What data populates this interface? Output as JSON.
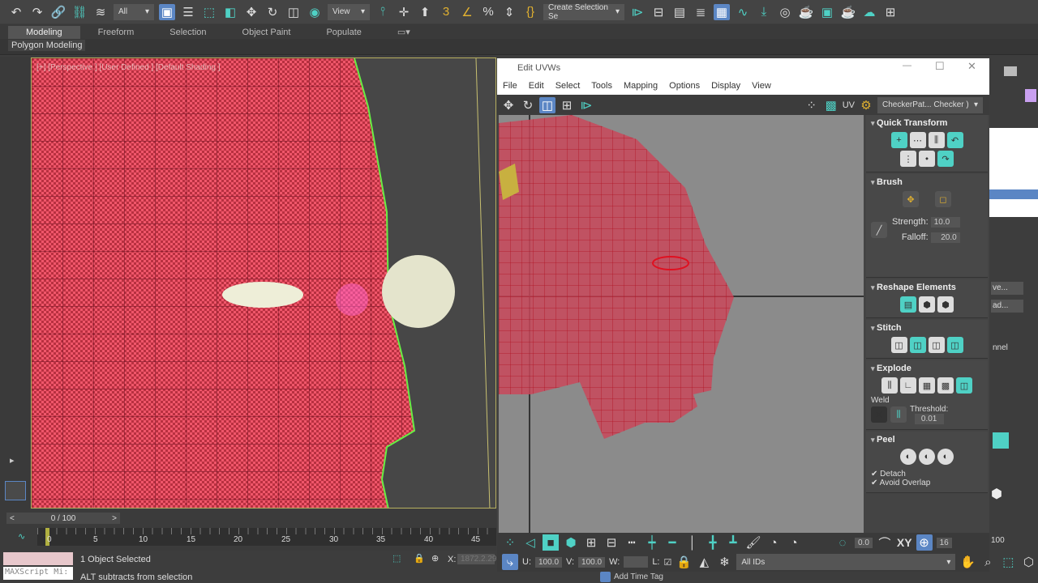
{
  "toolbar": {
    "filter_select": "All",
    "view_select": "View",
    "selection_set": "Create Selection Se"
  },
  "ribbon": {
    "tabs": [
      "Modeling",
      "Freeform",
      "Selection",
      "Object Paint",
      "Populate"
    ],
    "active": "Modeling",
    "sub": "Polygon Modeling"
  },
  "viewport": {
    "label": "[+] [Perspective ] [User Defined ] [Default Shading ]"
  },
  "uvw": {
    "title": "Edit UVWs",
    "menu": [
      "File",
      "Edit",
      "Select",
      "Tools",
      "Mapping",
      "Options",
      "Display",
      "View"
    ],
    "uv_label": "UV",
    "checker": "CheckerPat... Checker )",
    "rollouts": {
      "quick_transform": "Quick Transform",
      "brush": "Brush",
      "strength_label": "Strength:",
      "strength": "10.0",
      "falloff_label": "Falloff:",
      "falloff": "20.0",
      "reshape": "Reshape Elements",
      "stitch": "Stitch",
      "explode": "Explode",
      "weld": "Weld",
      "threshold_label": "Threshold:",
      "threshold": "0.01",
      "peel": "Peel",
      "detach": "Detach",
      "avoid_overlap": "Avoid Overlap"
    },
    "bottom": {
      "angle": "0.0",
      "xy": "XY",
      "grid": "16",
      "u_label": "U:",
      "u": "100.0",
      "v_label": "V:",
      "v": "100.0",
      "w_label": "W:",
      "l_label": "L:",
      "ids": "All IDs"
    }
  },
  "command_panel": {
    "items": [
      "ve...",
      "ad...",
      "nnel"
    ]
  },
  "timeline": {
    "frame": "0 / 100",
    "ticks": [
      "0",
      "5",
      "10",
      "15",
      "20",
      "25",
      "30",
      "35",
      "40",
      "45"
    ],
    "end": "100"
  },
  "status": {
    "selected": "1 Object Selected",
    "hint": "ALT subtracts from selection",
    "maxscript": "MAXScript Mi:",
    "x_label": "X:",
    "x_value": "1872.2.29",
    "add_time_tag": "Add Time Tag"
  },
  "colors": {
    "accent": "#4fd1c5",
    "mesh": "#e84a5f",
    "selection": "#5b86c4"
  }
}
